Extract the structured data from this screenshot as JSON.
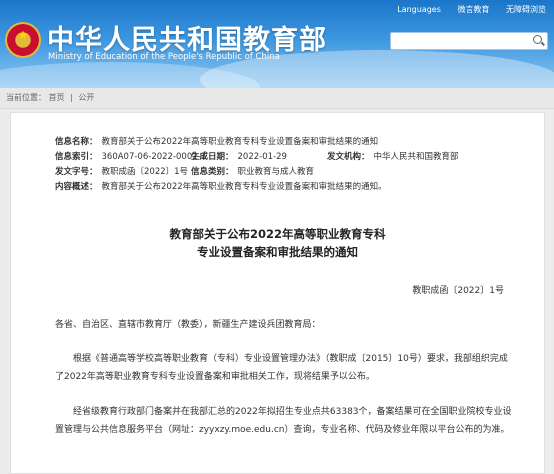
{
  "header": {
    "site_title": "中华人民共和国教育部",
    "site_subtitle": "Ministry of Education of the People's Republic of China",
    "links": [
      "Languages",
      "微言教育",
      "无障碍浏览"
    ]
  },
  "breadcrumb": {
    "current_position": "当前位置：",
    "home": "首页",
    "separator": "|",
    "section": "公开"
  },
  "meta": {
    "index_label": "信息名称：",
    "index_value": "教育部关于公布2022年高等职业教育专科专业设置备案和审批结果的通知",
    "code_label": "信息索引：",
    "code_value": "360A07-06-2022-0002-1",
    "date_label": "生成日期：",
    "date_value": "2022-01-29",
    "org_label": "发文机构：",
    "org_value": "中华人民共和国教育部",
    "docno_label": "发文字号：",
    "docno_value": "教职成函〔2022〕1号",
    "category_label": "信息类别：",
    "category_value": "职业教育与成人教育",
    "summary_label": "内容概述：",
    "summary_value": "教育部关于公布2022年高等职业教育专科专业设置备案和审批结果的通知。"
  },
  "document": {
    "title_line1": "教育部关于公布2022年高等职业教育专科",
    "title_line2": "专业设置备案和审批结果的通知",
    "doc_number": "教职成函〔2022〕1号",
    "salutation": "各省、自治区、直辖市教育厅（教委），新疆生产建设兵团教育局：",
    "para1_line1": "根据《普通高等学校高等职业教育（专科）专业设置管理办法》（教职成〔2015〕10号）要求，我部组织完成",
    "para1_line2": "了2022年高等职业教育专科专业设置备案和审批相关工作，现将结果予以公布。",
    "para2_line1": "经省级教育行政部门备案并在我部汇总的2022年拟招生专业点共63383个，备案结果可在全国职业院校专业设",
    "para2_line2": "置管理与公共信息服务平台（网址：zyyxzy.moe.edu.cn）查询，专业名称、代码及修业年限以平台公布的为准。"
  }
}
